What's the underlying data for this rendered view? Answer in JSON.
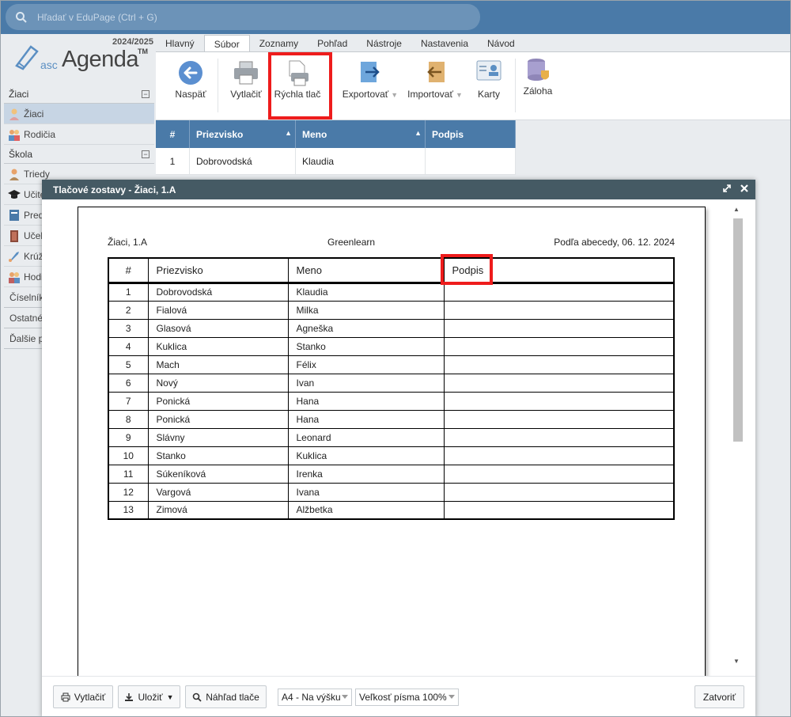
{
  "search": {
    "placeholder": "Hľadať v EduPage (Ctrl + G)"
  },
  "logo": {
    "year": "2024/2025",
    "asc": "asc",
    "agenda": "Agenda",
    "tm": "TM"
  },
  "sidebar": {
    "sections": [
      {
        "label": "Žiaci",
        "items": [
          "Žiaci",
          "Rodičia"
        ]
      },
      {
        "label": "Škola",
        "items": [
          "Triedy",
          "Učite",
          "Pred",
          "Učeb",
          "Krúž",
          "Hodi"
        ]
      }
    ],
    "plain": [
      "Číselník",
      "Ostatné",
      "Ďalšie p"
    ]
  },
  "ribbon": {
    "tabs": [
      "Hlavný",
      "Súbor",
      "Zoznamy",
      "Pohľad",
      "Nástroje",
      "Nastavenia",
      "Návod"
    ],
    "active_tab": "Súbor",
    "buttons": {
      "back": "Naspäť",
      "print": "Vytlačiť",
      "quick_print": "Rýchla tlač",
      "export": "Exportovať",
      "import": "Importovať",
      "cards": "Karty",
      "backup": "Záloha"
    }
  },
  "bg_table": {
    "headers": [
      "#",
      "Priezvisko",
      "Meno",
      "Podpis"
    ],
    "row": [
      "1",
      "Dobrovodská",
      "Klaudia",
      ""
    ]
  },
  "modal": {
    "title": "Tlačové zostavy - Žiaci, 1.A",
    "report": {
      "left": "Žiaci, 1.A",
      "center": "Greenlearn",
      "right": "Podľa abecedy, 06. 12. 2024",
      "headers": [
        "#",
        "Priezvisko",
        "Meno",
        "Podpis"
      ],
      "rows": [
        [
          "1",
          "Dobrovodská",
          "Klaudia",
          ""
        ],
        [
          "2",
          "Fialová",
          "Milka",
          ""
        ],
        [
          "3",
          "Glasová",
          "Agneška",
          ""
        ],
        [
          "4",
          "Kuklica",
          "Stanko",
          ""
        ],
        [
          "5",
          "Mach",
          "Félix",
          ""
        ],
        [
          "6",
          "Nový",
          "Ivan",
          ""
        ],
        [
          "7",
          "Ponická",
          "Hana",
          ""
        ],
        [
          "8",
          "Ponická",
          "Hana",
          ""
        ],
        [
          "9",
          "Slávny",
          "Leonard",
          ""
        ],
        [
          "10",
          "Stanko",
          "Kuklica",
          ""
        ],
        [
          "11",
          "Súkeníková",
          "Irenka",
          ""
        ],
        [
          "12",
          "Vargová",
          "Ivana",
          ""
        ],
        [
          "13",
          "Zimová",
          "Alžbetka",
          ""
        ]
      ]
    },
    "footer": {
      "print": "Vytlačiť",
      "save": "Uložiť",
      "preview": "Náhľad tlače",
      "paper": "A4 - Na výšku",
      "font_size": "Veľkosť písma 100%",
      "close": "Zatvoriť"
    }
  },
  "colors": {
    "accent": "#4a7aa8",
    "highlight": "#ee1c1c",
    "modal_title": "#455a64"
  }
}
